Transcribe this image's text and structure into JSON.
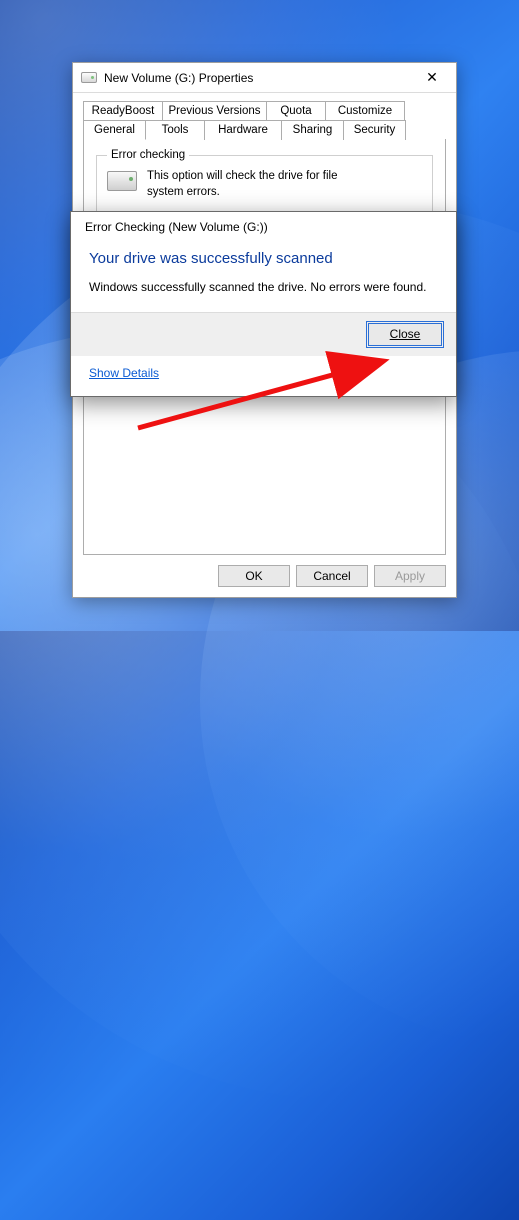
{
  "window": {
    "title": "New Volume (G:) Properties",
    "close_glyph": "✕"
  },
  "tabs": {
    "row1": [
      "ReadyBoost",
      "Previous Versions",
      "Quota",
      "Customize"
    ],
    "row2": [
      "General",
      "Tools",
      "Hardware",
      "Sharing",
      "Security"
    ],
    "active": "Tools"
  },
  "group": {
    "legend": "Error checking",
    "text": "This option will check the drive for file system errors."
  },
  "buttons": {
    "ok": "OK",
    "cancel": "Cancel",
    "apply": "Apply"
  },
  "dialog": {
    "head": "Error Checking (New Volume (G:))",
    "title": "Your drive was successfully scanned",
    "body": "Windows successfully scanned the drive. No errors were found.",
    "close": "Close",
    "details": "Show Details"
  }
}
